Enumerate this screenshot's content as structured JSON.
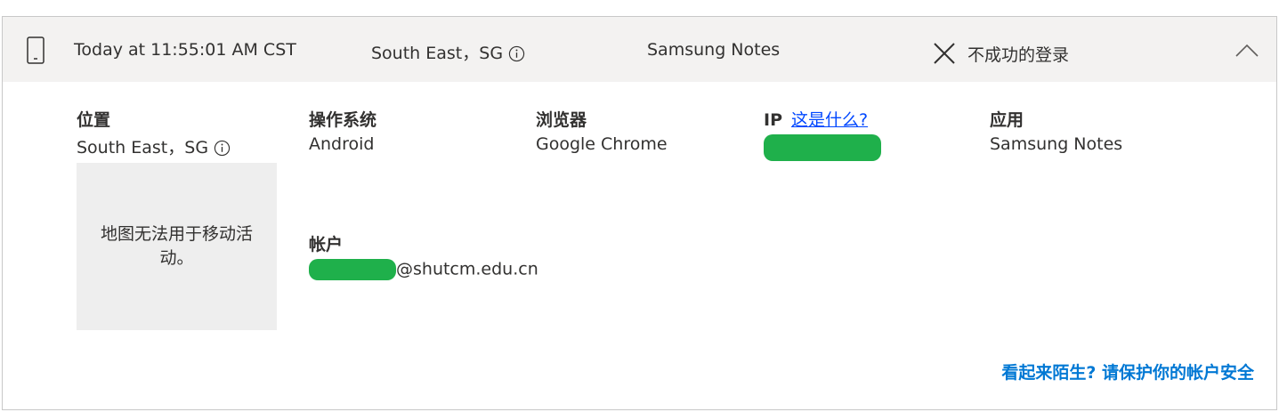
{
  "header": {
    "timestamp": "Today at 11:55:01 AM CST",
    "location": "South East，SG",
    "app": "Samsung Notes",
    "status": "不成功的登录",
    "icons": {
      "device": "phone-icon",
      "info": "info-icon",
      "status": "x-icon",
      "collapse": "chevron-up-icon"
    }
  },
  "details": {
    "location": {
      "label": "位置",
      "value": "South East，SG"
    },
    "os": {
      "label": "操作系统",
      "value": "Android"
    },
    "browser": {
      "label": "浏览器",
      "value": "Google Chrome"
    },
    "ip": {
      "label": "IP",
      "help_link": "这是什么?"
    },
    "app": {
      "label": "应用",
      "value": "Samsung Notes"
    },
    "account": {
      "label": "帐户",
      "value_suffix": "@shutcm.edu.cn"
    }
  },
  "map": {
    "message": "地图无法用于移动活动。"
  },
  "footer": {
    "link": "看起来陌生? 请保护你的帐户安全"
  },
  "colors": {
    "header_bg": "#f3f2f1",
    "link_blue": "#0047ff",
    "accent_blue": "#0078d4",
    "redaction_green": "#1fb04b"
  }
}
